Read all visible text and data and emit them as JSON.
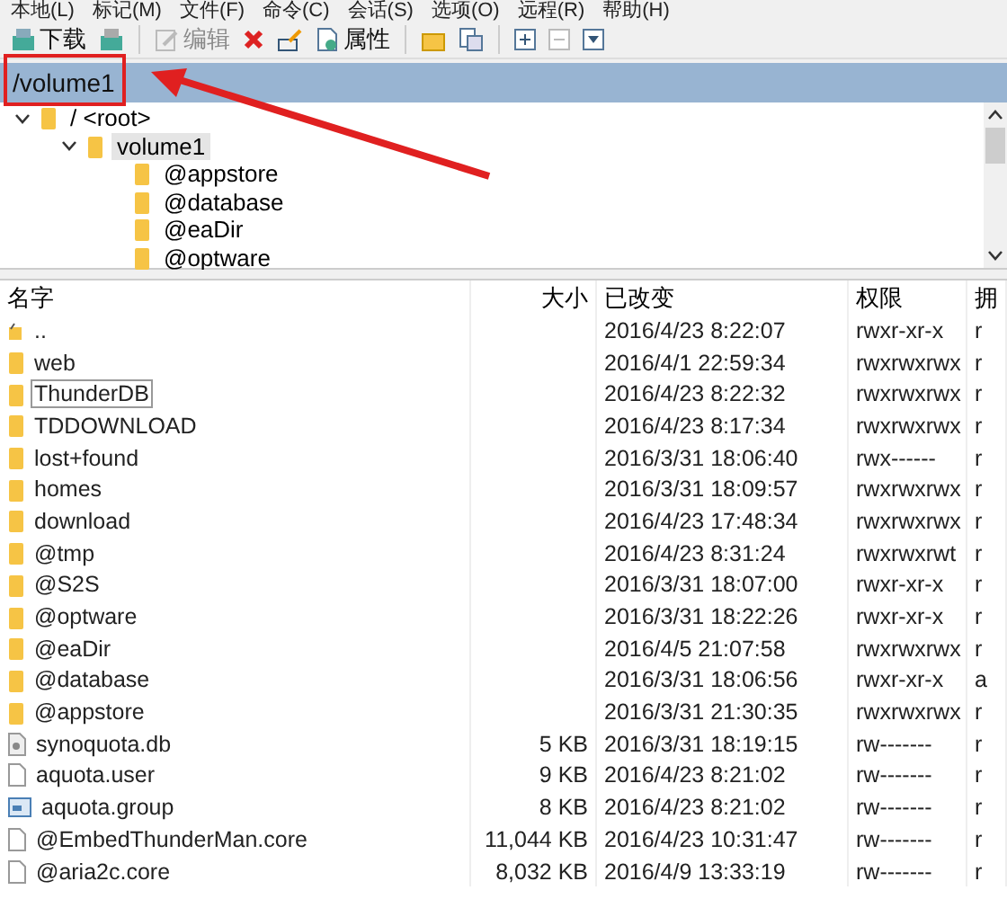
{
  "menu": [
    "本地(L)",
    "标记(M)",
    "文件(F)",
    "命令(C)",
    "会话(S)",
    "选项(O)",
    "远程(R)",
    "帮助(H)"
  ],
  "toolbar": [
    {
      "kind": "download",
      "label": "下载",
      "disabled": false
    },
    {
      "kind": "upload",
      "disabled": false
    },
    {
      "kind": "edit",
      "label": "编辑",
      "disabled": true
    },
    {
      "kind": "delete",
      "disabled": false
    },
    {
      "kind": "rename",
      "disabled": false
    },
    {
      "kind": "properties",
      "label": "属性",
      "disabled": false
    },
    {
      "kind": "newfolder",
      "disabled": false
    },
    {
      "kind": "copy",
      "disabled": false
    },
    {
      "kind": "plus",
      "disabled": false
    },
    {
      "kind": "minus",
      "disabled": true
    },
    {
      "kind": "filter",
      "disabled": false
    }
  ],
  "path": "/volume1",
  "tree": [
    {
      "label": "/ <root>",
      "expanded": true,
      "selected": false,
      "children": [
        {
          "label": "volume1",
          "expanded": true,
          "selected": true,
          "children": [
            {
              "label": "@appstore"
            },
            {
              "label": "@database"
            },
            {
              "label": "@eaDir"
            },
            {
              "label": "@optware"
            }
          ]
        }
      ]
    }
  ],
  "columns": [
    "名字",
    "大小",
    "已改变",
    "权限",
    "拥"
  ],
  "rows": [
    {
      "kind": "parent",
      "name": "..",
      "size": "",
      "modified": "2016/4/23 8:22:07",
      "perms": "rwxr-xr-x",
      "owner": "r",
      "focused": false
    },
    {
      "kind": "folder",
      "name": "web",
      "size": "",
      "modified": "2016/4/1 22:59:34",
      "perms": "rwxrwxrwx",
      "owner": "r",
      "focused": false
    },
    {
      "kind": "folder",
      "name": "ThunderDB",
      "size": "",
      "modified": "2016/4/23 8:22:32",
      "perms": "rwxrwxrwx",
      "owner": "r",
      "focused": true
    },
    {
      "kind": "folder",
      "name": "TDDOWNLOAD",
      "size": "",
      "modified": "2016/4/23 8:17:34",
      "perms": "rwxrwxrwx",
      "owner": "r",
      "focused": false
    },
    {
      "kind": "folder",
      "name": "lost+found",
      "size": "",
      "modified": "2016/3/31 18:06:40",
      "perms": "rwx------",
      "owner": "r",
      "focused": false
    },
    {
      "kind": "folder",
      "name": "homes",
      "size": "",
      "modified": "2016/3/31 18:09:57",
      "perms": "rwxrwxrwx",
      "owner": "r",
      "focused": false
    },
    {
      "kind": "folder",
      "name": "download",
      "size": "",
      "modified": "2016/4/23 17:48:34",
      "perms": "rwxrwxrwx",
      "owner": "r",
      "focused": false
    },
    {
      "kind": "folder",
      "name": "@tmp",
      "size": "",
      "modified": "2016/4/23 8:31:24",
      "perms": "rwxrwxrwt",
      "owner": "r",
      "focused": false
    },
    {
      "kind": "folder",
      "name": "@S2S",
      "size": "",
      "modified": "2016/3/31 18:07:00",
      "perms": "rwxr-xr-x",
      "owner": "r",
      "focused": false
    },
    {
      "kind": "folder",
      "name": "@optware",
      "size": "",
      "modified": "2016/3/31 18:22:26",
      "perms": "rwxr-xr-x",
      "owner": "r",
      "focused": false
    },
    {
      "kind": "folder",
      "name": "@eaDir",
      "size": "",
      "modified": "2016/4/5 21:07:58",
      "perms": "rwxrwxrwx",
      "owner": "r",
      "focused": false
    },
    {
      "kind": "folder",
      "name": "@database",
      "size": "",
      "modified": "2016/3/31 18:06:56",
      "perms": "rwxr-xr-x",
      "owner": "a",
      "focused": false
    },
    {
      "kind": "folder",
      "name": "@appstore",
      "size": "",
      "modified": "2016/3/31 21:30:35",
      "perms": "rwxrwxrwx",
      "owner": "r",
      "focused": false
    },
    {
      "kind": "db",
      "name": "synoquota.db",
      "size": "5 KB",
      "modified": "2016/3/31 18:19:15",
      "perms": "rw-------",
      "owner": "r",
      "focused": false
    },
    {
      "kind": "file",
      "name": "aquota.user",
      "size": "9 KB",
      "modified": "2016/4/23 8:21:02",
      "perms": "rw-------",
      "owner": "r",
      "focused": false
    },
    {
      "kind": "group",
      "name": "aquota.group",
      "size": "8 KB",
      "modified": "2016/4/23 8:21:02",
      "perms": "rw-------",
      "owner": "r",
      "focused": false
    },
    {
      "kind": "file",
      "name": "@EmbedThunderMan.core",
      "size": "11,044 KB",
      "modified": "2016/4/23 10:31:47",
      "perms": "rw-------",
      "owner": "r",
      "focused": false
    },
    {
      "kind": "file",
      "name": "@aria2c.core",
      "size": "8,032 KB",
      "modified": "2016/4/9 13:33:19",
      "perms": "rw-------",
      "owner": "r",
      "focused": false
    }
  ]
}
